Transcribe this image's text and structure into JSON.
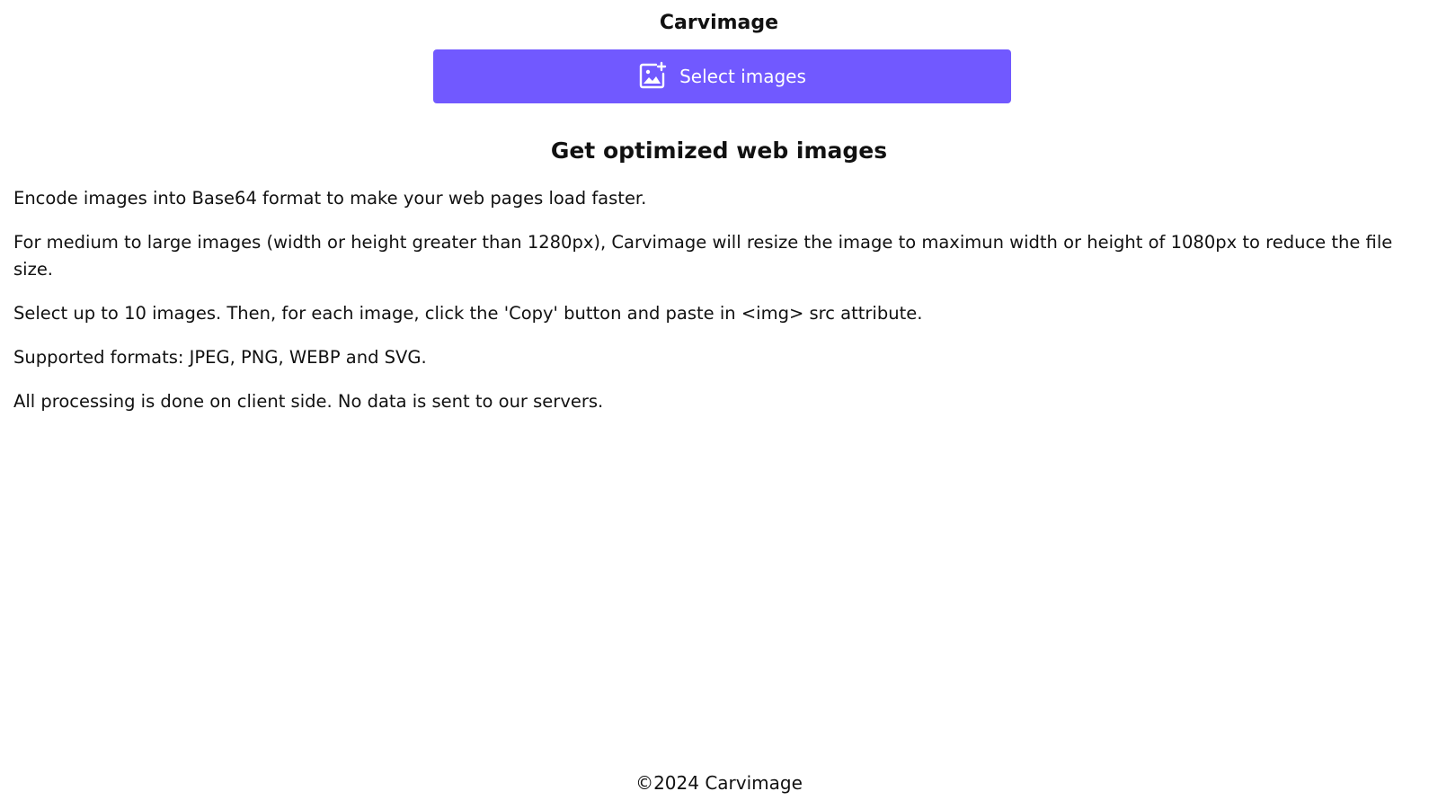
{
  "header": {
    "title": "Carvimage"
  },
  "upload": {
    "button_label": "Select images",
    "button_icon": "image-plus-icon",
    "button_color": "#7159ff"
  },
  "main": {
    "headline": "Get optimized web images",
    "paragraphs": [
      "Encode images into Base64 format to make your web pages load faster.",
      "For medium to large images (width or height greater than 1280px), Carvimage will resize the image to maximun width or height of 1080px to reduce the file size.",
      "Select up to 10 images. Then, for each image, click the 'Copy' button and paste in <img> src attribute.",
      "Supported formats: JPEG, PNG, WEBP and SVG.",
      "All processing is done on client side. No data is sent to our servers."
    ]
  },
  "footer": {
    "text": "©2024 Carvimage"
  }
}
